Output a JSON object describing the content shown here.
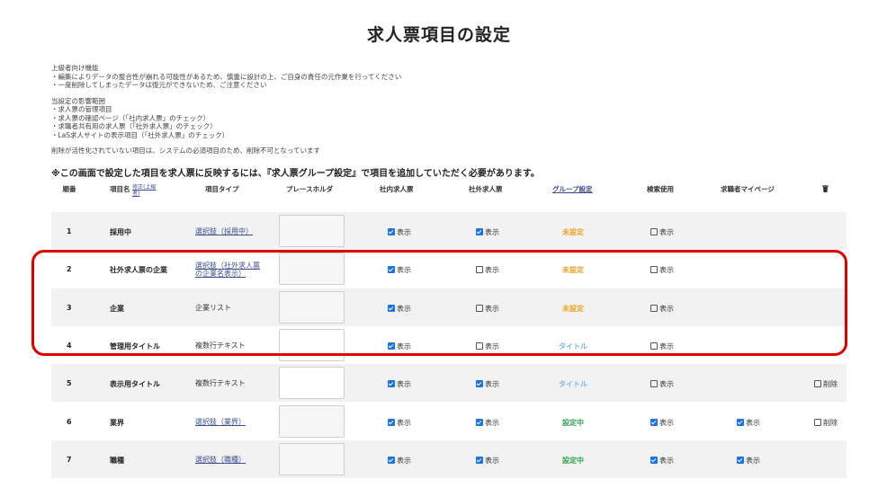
{
  "title": "求人票項目の設定",
  "notes": [
    [
      "上級者向け機能",
      "・編集によりデータの整合性が崩れる可能性があるため、慎重に設計の上、ご自身の責任の元作業を行ってください",
      "・一度削除してしまったデータは復元ができないため、ご注意ください"
    ],
    [
      "当設定の影響範囲",
      "・求人票の管理項目",
      "・求人票の確認ページ（「社内求人票」のチェック）",
      "・求職者共有用の求人票（「社外求人票」のチェック）",
      "・LaS求人サイトの表示項目（「社外求人票」のチェック）"
    ],
    [
      "削除が活性化されていない項目は、システムの必須項目のため、削除不可となっています"
    ]
  ],
  "notice": "※この画面で設定した項目を求人票に反映するには、『求人票グループ設定』で項目を追加していただく必要があります。",
  "headers": {
    "no": "順番",
    "name": "項目名",
    "name_link": "修正(上級者)",
    "type": "項目タイプ",
    "placeholder": "プレースホルダ",
    "internal": "社内求人票",
    "external": "社外求人票",
    "group": "グループ設定",
    "search": "検索使用",
    "mypage": "求職者マイページ"
  },
  "labels": {
    "show": "表示",
    "delete": "削除"
  },
  "colors": {
    "unset": "#f0a020",
    "title_group": "#7ab8e0",
    "set": "#2e9e4a",
    "highlight": "#e00000",
    "check": "#1a73e8"
  },
  "rows": [
    {
      "no": "1",
      "name": "採用中",
      "type": "選択肢（採用中）",
      "type_link": true,
      "ph_white": false,
      "internal": true,
      "external": true,
      "group": "未設定",
      "group_color": "#f0a020",
      "search": false,
      "mypage": null,
      "delete": null,
      "gray": true
    },
    {
      "no": "2",
      "name": "社外求人票の企業",
      "type": "選択肢（社外求人票の企業名表示）",
      "type_link": true,
      "ph_white": false,
      "internal": true,
      "external": false,
      "group": "未設定",
      "group_color": "#f0a020",
      "search": false,
      "mypage": null,
      "delete": null,
      "gray": false
    },
    {
      "no": "3",
      "name": "企業",
      "type": "企業リスト",
      "type_link": false,
      "ph_white": false,
      "internal": true,
      "external": false,
      "group": "未設定",
      "group_color": "#f0a020",
      "search": false,
      "mypage": null,
      "delete": null,
      "gray": true
    },
    {
      "no": "4",
      "name": "管理用タイトル",
      "type": "複数行テキスト",
      "type_link": false,
      "ph_white": true,
      "internal": true,
      "external": false,
      "group": "タイトル",
      "group_color": "#7ab8e0",
      "search": false,
      "mypage": null,
      "delete": null,
      "gray": false
    },
    {
      "no": "5",
      "name": "表示用タイトル",
      "type": "複数行テキスト",
      "type_link": false,
      "ph_white": true,
      "internal": true,
      "external": true,
      "group": "タイトル",
      "group_color": "#7ab8e0",
      "search": false,
      "mypage": null,
      "delete": false,
      "gray": true
    },
    {
      "no": "6",
      "name": "業界",
      "type": "選択肢（業界）",
      "type_link": true,
      "ph_white": false,
      "internal": true,
      "external": true,
      "group": "設定中",
      "group_color": "#2e9e4a",
      "search": true,
      "mypage": true,
      "delete": false,
      "gray": false
    },
    {
      "no": "7",
      "name": "職種",
      "type": "選択肢（職種）",
      "type_link": true,
      "ph_white": false,
      "internal": true,
      "external": true,
      "group": "設定中",
      "group_color": "#2e9e4a",
      "search": true,
      "mypage": true,
      "delete": null,
      "gray": true
    }
  ]
}
